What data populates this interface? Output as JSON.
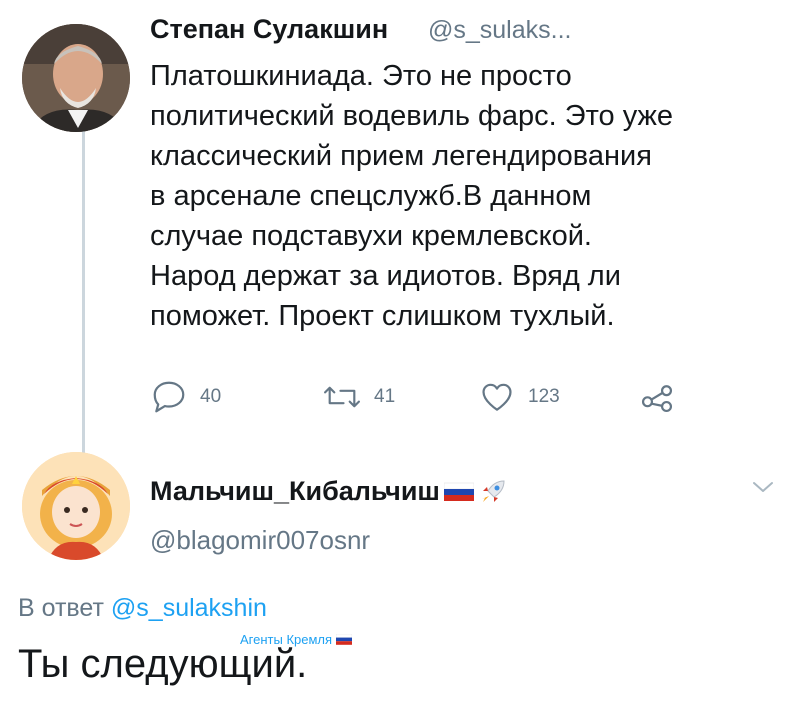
{
  "thread": {
    "tweets": [
      {
        "author_name": "Степан Сулакшин",
        "author_handle": "@s_sulaks...",
        "text": "Платошкиниада. Это не просто\nполитический водевиль фарс. Это уже\nклассический прием легендирования\nв арсенале спецслужб.В данном\nслучае подставухи кремлевской.\nНарод держат за идиотов. Вряд ли\nпоможет. Проект слишком тухлый.",
        "actions": {
          "reply_count": "40",
          "retweet_count": "41",
          "like_count": "123"
        }
      },
      {
        "author_name": "Мальчиш_Кибальчиш",
        "author_handle": "@blagomir007osnr",
        "reply_prefix": "В ответ",
        "reply_mention": "@s_sulakshin",
        "text": "Ты следующий."
      }
    ]
  },
  "watermark": {
    "text": "Агенты Кремля"
  },
  "icons": {
    "reply": "reply-icon",
    "retweet": "retweet-icon",
    "like": "heart-icon",
    "share": "share-icon",
    "flag": "russia-flag-icon",
    "rocket": "rocket-icon",
    "more": "chevron-down-icon"
  },
  "colors": {
    "text": "#14171a",
    "secondary": "#657786",
    "link": "#1da1f2",
    "thread_line": "#ccd6dd"
  }
}
